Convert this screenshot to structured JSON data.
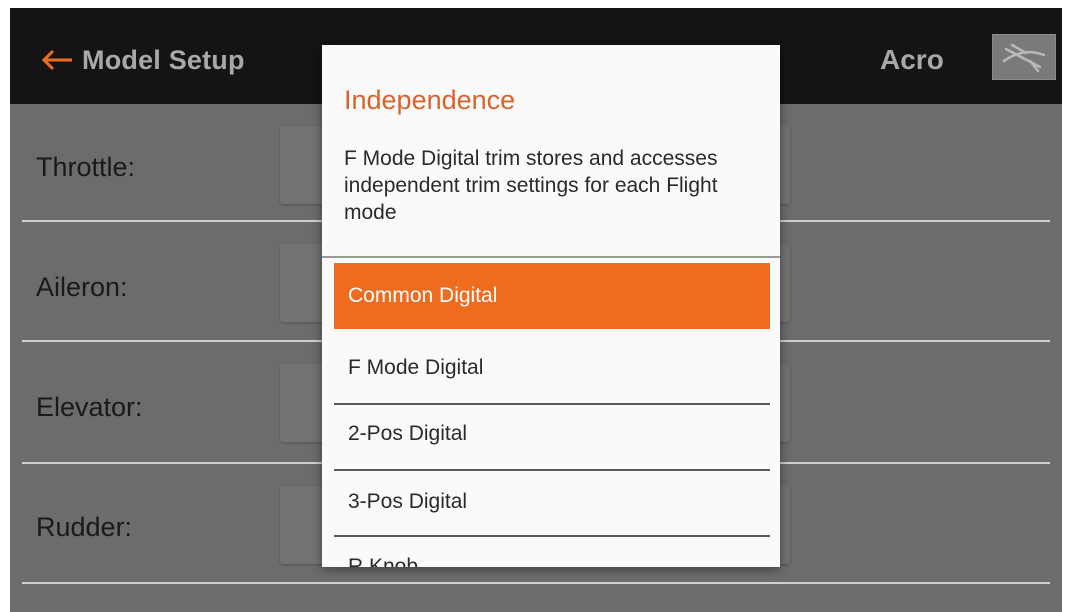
{
  "header": {
    "back_icon": "left-arrow-icon",
    "title": "Model Setup",
    "model_name": "Acro",
    "model_icon": "airplane-icon",
    "accent_color": "#ef6c1e"
  },
  "rows": [
    {
      "label": "Throttle:"
    },
    {
      "label": "Aileron:"
    },
    {
      "label": "Elevator:"
    },
    {
      "label": "Rudder:"
    }
  ],
  "popup": {
    "title": "Independence",
    "description": "F Mode Digital trim stores and accesses independent trim settings for each Flight mode",
    "options": [
      {
        "label": "Common Digital",
        "selected": true
      },
      {
        "label": "F Mode Digital",
        "selected": false
      },
      {
        "label": "2-Pos Digital",
        "selected": false
      },
      {
        "label": "3-Pos Digital",
        "selected": false
      },
      {
        "label": "R Knob",
        "selected": false
      }
    ]
  }
}
